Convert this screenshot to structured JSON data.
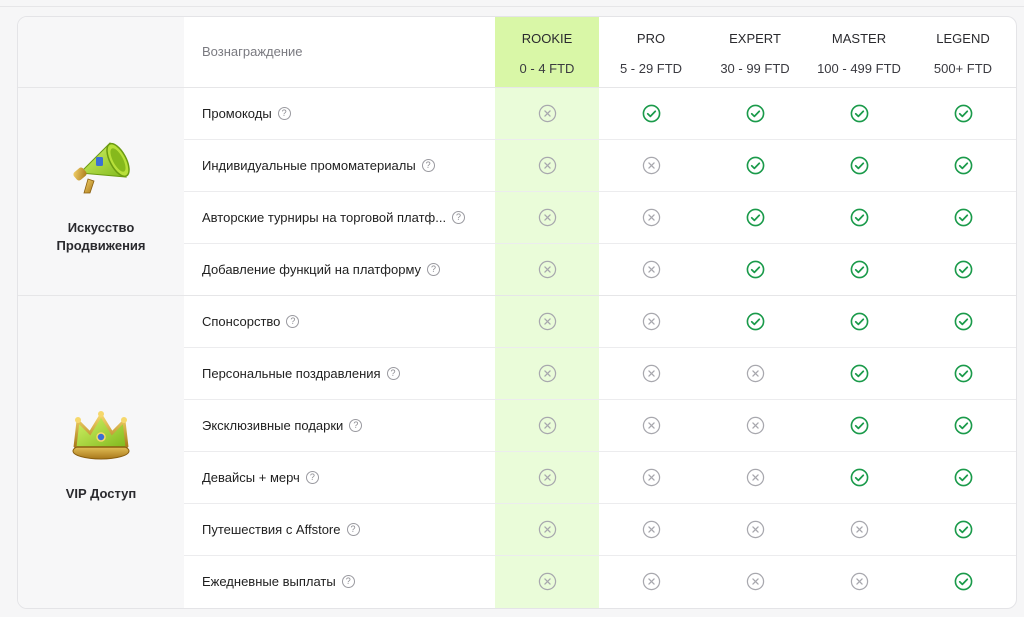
{
  "header": {
    "reward_label": "Вознаграждение",
    "tiers": [
      {
        "name": "ROOKIE",
        "range": "0 - 4 FTD"
      },
      {
        "name": "PRO",
        "range": "5 - 29 FTD"
      },
      {
        "name": "EXPERT",
        "range": "30 - 99 FTD"
      },
      {
        "name": "MASTER",
        "range": "100 - 499 FTD"
      },
      {
        "name": "LEGEND",
        "range": "500+ FTD"
      }
    ]
  },
  "groups": [
    {
      "title_line1": "Искусство",
      "title_line2": "Продвижения",
      "icon": "megaphone-icon"
    },
    {
      "title_line1": "VIP Доступ",
      "title_line2": "",
      "icon": "crown-icon"
    }
  ],
  "rows": [
    {
      "label": "Промокоды",
      "values": [
        false,
        true,
        true,
        true,
        true
      ]
    },
    {
      "label": "Индивидуальные промоматериалы",
      "values": [
        false,
        false,
        true,
        true,
        true
      ]
    },
    {
      "label": "Авторские турниры на торговой платф...",
      "values": [
        false,
        false,
        true,
        true,
        true
      ]
    },
    {
      "label": "Добавление функций на платформу",
      "values": [
        false,
        false,
        true,
        true,
        true
      ]
    },
    {
      "label": "Спонсорство",
      "values": [
        false,
        false,
        true,
        true,
        true
      ]
    },
    {
      "label": "Персональные поздравления",
      "values": [
        false,
        false,
        false,
        true,
        true
      ]
    },
    {
      "label": "Эксклюзивные подарки",
      "values": [
        false,
        false,
        false,
        true,
        true
      ]
    },
    {
      "label": "Девайсы + мерч",
      "values": [
        false,
        false,
        false,
        true,
        true
      ]
    },
    {
      "label": "Путешествия с Affstore",
      "values": [
        false,
        false,
        false,
        false,
        true
      ]
    },
    {
      "label": "Ежедневные выплаты",
      "values": [
        false,
        false,
        false,
        false,
        true
      ]
    }
  ],
  "help_glyph": "?",
  "colors": {
    "check": "#1a9a4a",
    "cross": "#a8a8ae",
    "rookie_bg": "#eafcd9",
    "rookie_header": "#d9f7a7"
  }
}
